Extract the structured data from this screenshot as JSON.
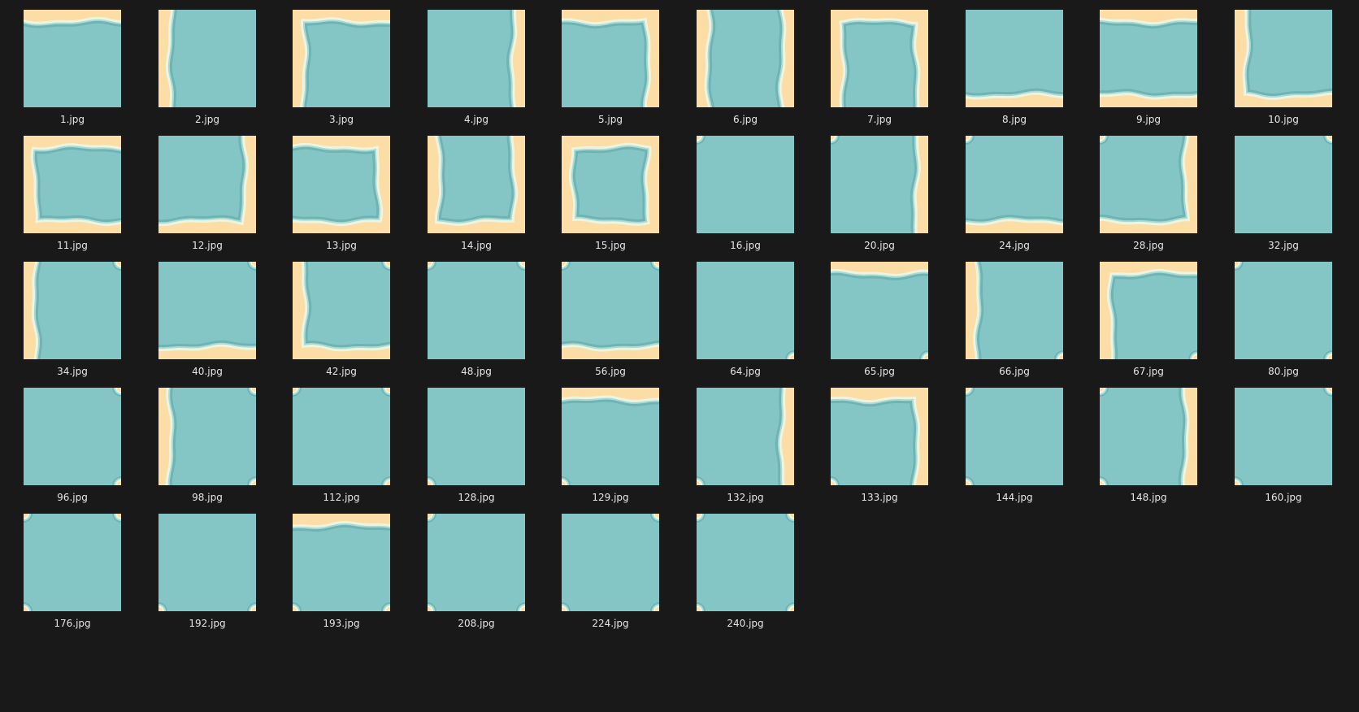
{
  "explorer": {
    "background": "#191919",
    "colors": {
      "water": "#84c6c6",
      "sand": "#fbdda5",
      "foam_dark": "#6fb4b4",
      "foam_light": "#a8dbd7",
      "foam_white": "#eef4dd"
    },
    "files": [
      {
        "name": "1.jpg",
        "shores": [
          "top"
        ],
        "corners": []
      },
      {
        "name": "2.jpg",
        "shores": [
          "left"
        ],
        "corners": []
      },
      {
        "name": "3.jpg",
        "shores": [
          "top",
          "left"
        ],
        "corners": []
      },
      {
        "name": "4.jpg",
        "shores": [
          "right"
        ],
        "corners": []
      },
      {
        "name": "5.jpg",
        "shores": [
          "top",
          "right"
        ],
        "corners": []
      },
      {
        "name": "6.jpg",
        "shores": [
          "left",
          "right"
        ],
        "corners": []
      },
      {
        "name": "7.jpg",
        "shores": [
          "top",
          "left",
          "right"
        ],
        "corners": []
      },
      {
        "name": "8.jpg",
        "shores": [
          "bottom"
        ],
        "corners": []
      },
      {
        "name": "9.jpg",
        "shores": [
          "top",
          "bottom"
        ],
        "corners": []
      },
      {
        "name": "10.jpg",
        "shores": [
          "left",
          "bottom"
        ],
        "corners": []
      },
      {
        "name": "11.jpg",
        "shores": [
          "top",
          "left",
          "bottom"
        ],
        "corners": []
      },
      {
        "name": "12.jpg",
        "shores": [
          "right",
          "bottom"
        ],
        "corners": []
      },
      {
        "name": "13.jpg",
        "shores": [
          "top",
          "right",
          "bottom"
        ],
        "corners": []
      },
      {
        "name": "14.jpg",
        "shores": [
          "left",
          "right",
          "bottom"
        ],
        "corners": []
      },
      {
        "name": "15.jpg",
        "shores": [
          "top",
          "left",
          "right",
          "bottom"
        ],
        "corners": []
      },
      {
        "name": "16.jpg",
        "shores": [],
        "corners": [
          "tl"
        ]
      },
      {
        "name": "20.jpg",
        "shores": [
          "right"
        ],
        "corners": [
          "tl"
        ]
      },
      {
        "name": "24.jpg",
        "shores": [
          "bottom"
        ],
        "corners": [
          "tl"
        ]
      },
      {
        "name": "28.jpg",
        "shores": [
          "right",
          "bottom"
        ],
        "corners": [
          "tl"
        ]
      },
      {
        "name": "32.jpg",
        "shores": [],
        "corners": [
          "tr"
        ]
      },
      {
        "name": "34.jpg",
        "shores": [
          "left"
        ],
        "corners": [
          "tr"
        ]
      },
      {
        "name": "40.jpg",
        "shores": [
          "bottom"
        ],
        "corners": [
          "tr"
        ]
      },
      {
        "name": "42.jpg",
        "shores": [
          "left",
          "bottom"
        ],
        "corners": [
          "tr"
        ]
      },
      {
        "name": "48.jpg",
        "shores": [],
        "corners": [
          "tl",
          "tr"
        ]
      },
      {
        "name": "56.jpg",
        "shores": [
          "bottom"
        ],
        "corners": [
          "tl",
          "tr"
        ]
      },
      {
        "name": "64.jpg",
        "shores": [],
        "corners": [
          "br"
        ]
      },
      {
        "name": "65.jpg",
        "shores": [
          "top"
        ],
        "corners": [
          "br"
        ]
      },
      {
        "name": "66.jpg",
        "shores": [
          "left"
        ],
        "corners": [
          "br"
        ]
      },
      {
        "name": "67.jpg",
        "shores": [
          "top",
          "left"
        ],
        "corners": [
          "br"
        ]
      },
      {
        "name": "80.jpg",
        "shores": [],
        "corners": [
          "tl",
          "br"
        ]
      },
      {
        "name": "96.jpg",
        "shores": [],
        "corners": [
          "tr",
          "br"
        ]
      },
      {
        "name": "98.jpg",
        "shores": [
          "left"
        ],
        "corners": [
          "tr",
          "br"
        ]
      },
      {
        "name": "112.jpg",
        "shores": [],
        "corners": [
          "tl",
          "tr",
          "br"
        ]
      },
      {
        "name": "128.jpg",
        "shores": [],
        "corners": [
          "bl"
        ]
      },
      {
        "name": "129.jpg",
        "shores": [
          "top"
        ],
        "corners": [
          "bl"
        ]
      },
      {
        "name": "132.jpg",
        "shores": [
          "right"
        ],
        "corners": [
          "bl"
        ]
      },
      {
        "name": "133.jpg",
        "shores": [
          "top",
          "right"
        ],
        "corners": [
          "bl"
        ]
      },
      {
        "name": "144.jpg",
        "shores": [],
        "corners": [
          "tl",
          "bl"
        ]
      },
      {
        "name": "148.jpg",
        "shores": [
          "right"
        ],
        "corners": [
          "tl",
          "bl"
        ]
      },
      {
        "name": "160.jpg",
        "shores": [],
        "corners": [
          "tr",
          "bl"
        ]
      },
      {
        "name": "176.jpg",
        "shores": [],
        "corners": [
          "tl",
          "tr",
          "bl"
        ]
      },
      {
        "name": "192.jpg",
        "shores": [],
        "corners": [
          "br",
          "bl"
        ]
      },
      {
        "name": "193.jpg",
        "shores": [
          "top"
        ],
        "corners": [
          "br",
          "bl"
        ]
      },
      {
        "name": "208.jpg",
        "shores": [],
        "corners": [
          "tl",
          "br",
          "bl"
        ]
      },
      {
        "name": "224.jpg",
        "shores": [],
        "corners": [
          "tr",
          "br",
          "bl"
        ]
      },
      {
        "name": "240.jpg",
        "shores": [],
        "corners": [
          "tl",
          "tr",
          "br",
          "bl"
        ]
      }
    ]
  }
}
